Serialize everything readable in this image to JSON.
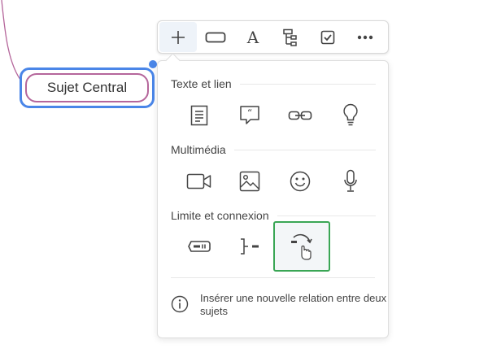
{
  "topic": {
    "label": "Sujet Central"
  },
  "toolbar": {
    "buttons": [
      {
        "name": "add-topic-button",
        "icon": "plus-icon"
      },
      {
        "name": "shape-button",
        "icon": "rounded-rectangle-icon"
      },
      {
        "name": "text-style-button",
        "icon": "text-format-icon",
        "label": "A"
      },
      {
        "name": "structure-button",
        "icon": "tree-structure-icon"
      },
      {
        "name": "task-button",
        "icon": "checkbox-icon"
      },
      {
        "name": "more-button",
        "icon": "more-horizontal-icon"
      }
    ]
  },
  "panel": {
    "sections": [
      {
        "title": "Texte et lien",
        "items": [
          "note-icon",
          "comment-icon",
          "link-icon",
          "idea-bulb-icon"
        ]
      },
      {
        "title": "Multimédia",
        "items": [
          "video-icon",
          "image-icon",
          "emoji-icon",
          "microphone-icon"
        ]
      },
      {
        "title": "Limite et connexion",
        "items": [
          "boundary-icon",
          "summary-icon",
          "relationship-icon"
        ]
      }
    ],
    "info_text": "Insérer une nouvelle relation entre deux sujets"
  },
  "colors": {
    "selection_blue": "#4a86e8",
    "topic_border": "#b5669b",
    "highlight_green": "#3aa655"
  }
}
